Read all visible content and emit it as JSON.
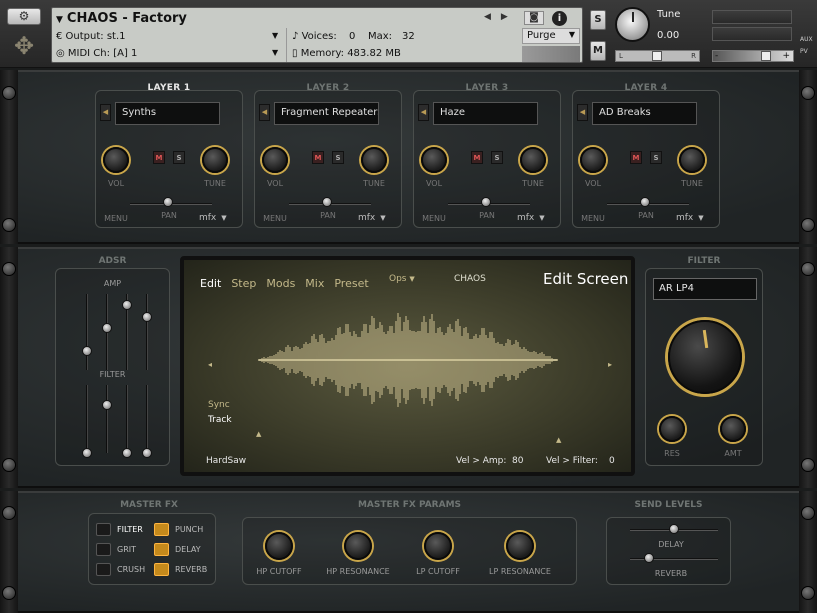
{
  "header": {
    "wrench_icon": "wrench-icon",
    "instrument_name": "CHAOS - Factory",
    "output_label": "Output:",
    "output_value": "st.1",
    "midi_label": "MIDI Ch:",
    "midi_value": "[A]  1",
    "voices_label": "Voices:",
    "voices_value": "0",
    "max_label": "Max:",
    "max_value": "32",
    "memory_label": "Memory:",
    "memory_value": "483.82 MB",
    "purge_label": "Purge",
    "solo_label": "S",
    "mute_label": "M",
    "tune_label": "Tune",
    "tune_value": "0.00",
    "pan_left": "L",
    "pan_right": "R",
    "aux_label": "AUX",
    "pv_label": "PV",
    "vol_minus": "-",
    "vol_plus": "+"
  },
  "layers": [
    {
      "title": "LAYER 1",
      "preset": "Synths",
      "active": true
    },
    {
      "title": "LAYER 2",
      "preset": "Fragment Repeaters",
      "active": false
    },
    {
      "title": "LAYER 3",
      "preset": "Haze",
      "active": false
    },
    {
      "title": "LAYER 4",
      "preset": "AD Breaks",
      "active": false
    }
  ],
  "layer_controls": {
    "mute": "M",
    "solo": "S",
    "vol": "VOL",
    "tune": "TUNE",
    "pan": "PAN",
    "menu": "MENU",
    "mfx": "mfx"
  },
  "adsr": {
    "title": "ADSR",
    "amp": "AMP",
    "filter": "FILTER",
    "amp_levels": [
      0.25,
      0.55,
      0.85,
      0.7
    ],
    "filter_levels": [
      0.0,
      0.7,
      0.0,
      0.0
    ]
  },
  "screen": {
    "menu": [
      "Edit",
      "Step",
      "Mods",
      "Mix",
      "Preset"
    ],
    "ops": "Ops",
    "patch_name": "CHAOS",
    "screen_title": "Edit Screen",
    "sync": "Sync",
    "track": "Track",
    "wave_name": "HardSaw",
    "vel_amp_label": "Vel > Amp:",
    "vel_amp_value": "80",
    "vel_filter_label": "Vel > Filter:",
    "vel_filter_value": "0"
  },
  "filter": {
    "title": "FILTER",
    "type": "AR LP4",
    "res": "RES",
    "amt": "AMT"
  },
  "master_fx": {
    "title": "MASTER FX",
    "items": [
      {
        "label": "FILTER",
        "on": false,
        "active": true
      },
      {
        "label": "GRIT",
        "on": false,
        "active": false
      },
      {
        "label": "CRUSH",
        "on": false,
        "active": false
      },
      {
        "label": "PUNCH",
        "on": true,
        "active": false
      },
      {
        "label": "DELAY",
        "on": true,
        "active": false
      },
      {
        "label": "REVERB",
        "on": true,
        "active": false
      }
    ]
  },
  "fx_params": {
    "title": "MASTER FX PARAMS",
    "knobs": [
      "HP CUTOFF",
      "HP RESONANCE",
      "LP CUTOFF",
      "LP RESONANCE"
    ]
  },
  "send_levels": {
    "title": "SEND LEVELS",
    "delay": "DELAY",
    "reverb": "REVERB"
  }
}
